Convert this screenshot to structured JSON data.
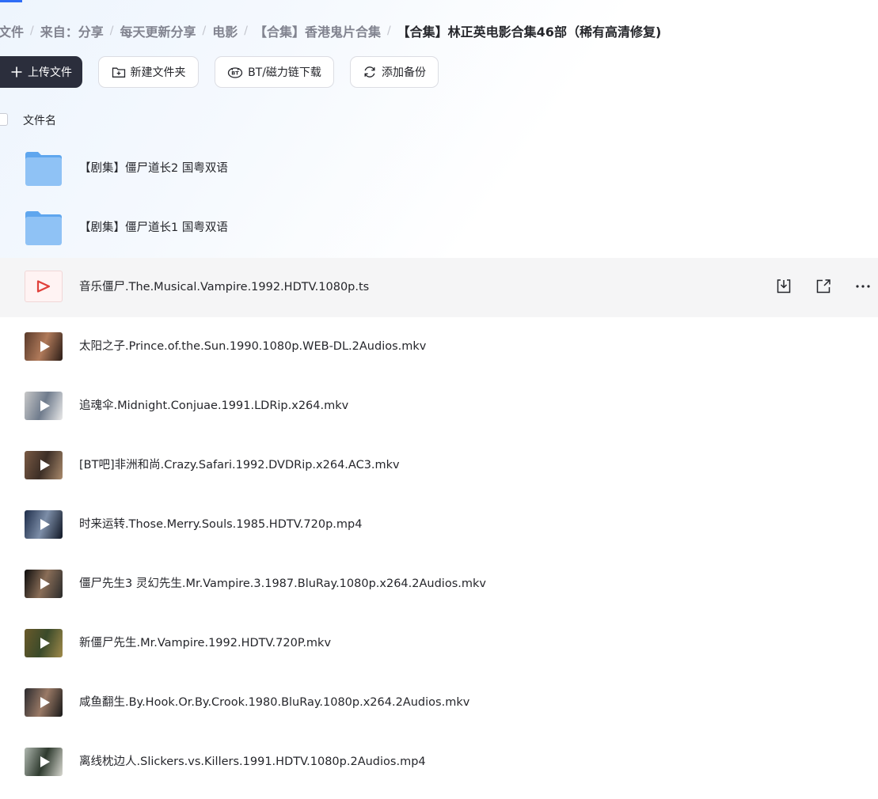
{
  "breadcrumb": [
    {
      "label": "文件"
    },
    {
      "label": "来自：分享"
    },
    {
      "label": "每天更新分享"
    },
    {
      "label": "电影"
    },
    {
      "label": "【合集】香港鬼片合集"
    },
    {
      "label": "【合集】林正英电影合集46部（稀有高清修复)"
    }
  ],
  "breadcrumb_separator": "/",
  "toolbar": {
    "upload_label": "上传文件",
    "new_folder_label": "新建文件夹",
    "bt_label": "BT/磁力链下载",
    "backup_label": "添加备份"
  },
  "list_header": {
    "name_label": "文件名"
  },
  "colors": {
    "primary_dark": "#2b2e3c",
    "accent_blue": "#2f6df6",
    "folder_blue": "#8fc2f5",
    "ts_red": "#e0403a"
  },
  "files": [
    {
      "name": "【剧集】僵尸道长2 国粤双语",
      "type": "folder",
      "icon": "folder-icon"
    },
    {
      "name": "【剧集】僵尸道长1 国粤双语",
      "type": "folder",
      "icon": "folder-icon"
    },
    {
      "name": "音乐僵尸.The.Musical.Vampire.1992.HDTV.1080p.ts",
      "type": "ts",
      "icon": "video-file-icon",
      "hover": true
    },
    {
      "name": "太阳之子.Prince.of.the.Sun.1990.1080p.WEB-DL.2Audios.mkv",
      "type": "video",
      "icon": "video-thumbnail",
      "tint": [
        "#5a3a2a",
        "#b07a5a",
        "#2a1c16"
      ]
    },
    {
      "name": "追魂伞.Midnight.Conjuae.1991.LDRip.x264.mkv",
      "type": "video",
      "icon": "video-thumbnail",
      "tint": [
        "#c8c8c8",
        "#6f7b8c",
        "#e9e9e9"
      ]
    },
    {
      "name": "[BT吧]非洲和尚.Crazy.Safari.1992.DVDRip.x264.AC3.mkv",
      "type": "video",
      "icon": "video-thumbnail",
      "tint": [
        "#7a5a44",
        "#3c2e26",
        "#a98a6c"
      ]
    },
    {
      "name": "时来运转.Those.Merry.Souls.1985.HDTV.720p.mp4",
      "type": "video",
      "icon": "video-thumbnail",
      "tint": [
        "#1e2d4a",
        "#7d8ea8",
        "#0f1624"
      ]
    },
    {
      "name": "僵尸先生3 灵幻先生.Mr.Vampire.3.1987.BluRay.1080p.x264.2Audios.mkv",
      "type": "video",
      "icon": "video-thumbnail",
      "tint": [
        "#0c0c0c",
        "#8a6e58",
        "#2a2a2a"
      ]
    },
    {
      "name": "新僵尸先生.Mr.Vampire.1992.HDTV.720P.mkv",
      "type": "video",
      "icon": "video-thumbnail",
      "tint": [
        "#6a5a2a",
        "#3a4a2a",
        "#a08a4a"
      ]
    },
    {
      "name": "咸鱼翻生.By.Hook.Or.By.Crook.1980.BluRay.1080p.x264.2Audios.mkv",
      "type": "video",
      "icon": "video-thumbnail",
      "tint": [
        "#2a2a2e",
        "#9a7a66",
        "#181818"
      ]
    },
    {
      "name": "离线枕边人.Slickers.vs.Killers.1991.HDTV.1080p.2Audios.mp4",
      "type": "video",
      "icon": "video-thumbnail",
      "tint": [
        "#b0b8b0",
        "#2e3a2e",
        "#d8d8d0"
      ]
    }
  ],
  "row_actions": [
    {
      "icon": "download-icon"
    },
    {
      "icon": "share-icon"
    },
    {
      "icon": "more-icon"
    }
  ]
}
